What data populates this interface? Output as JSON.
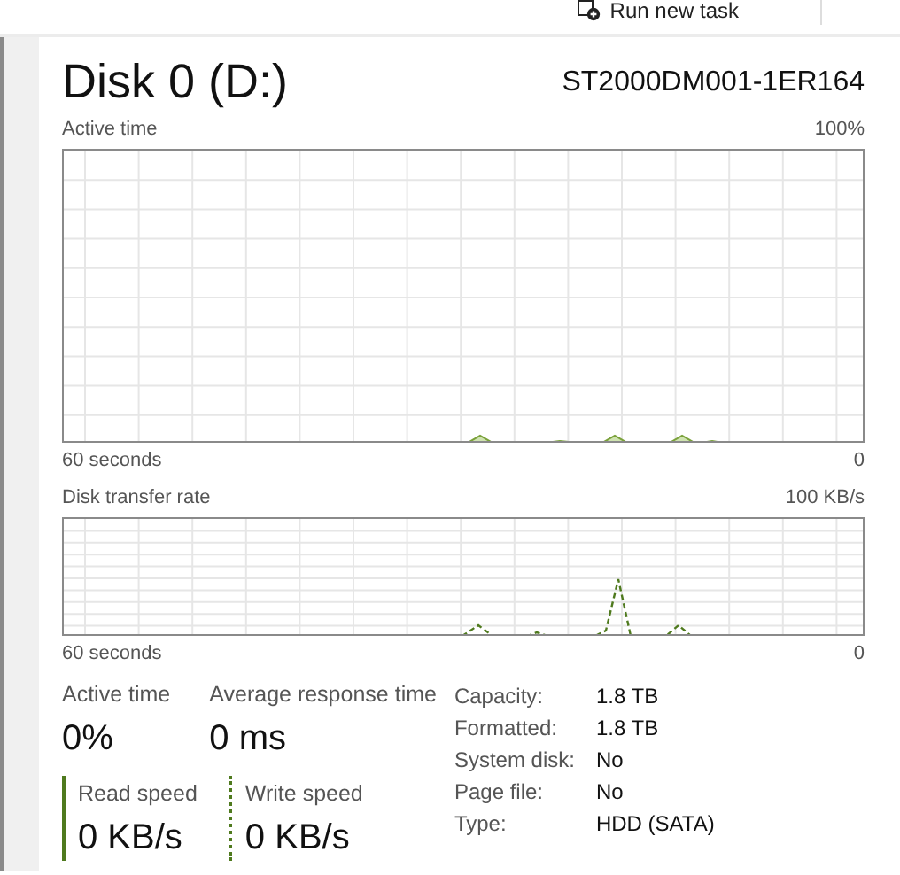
{
  "toolbar": {
    "run_new_task": "Run new task"
  },
  "header": {
    "title": "Disk 0 (D:)",
    "model": "ST2000DM001-1ER164"
  },
  "graphs": [
    {
      "kind": "active",
      "label": "Active time",
      "max": "100%",
      "time_span": "60 seconds",
      "min": "0"
    },
    {
      "kind": "transfer",
      "label": "Disk transfer rate",
      "max": "100 KB/s",
      "time_span": "60 seconds",
      "min": "0"
    }
  ],
  "stats": [
    {
      "label": "Active time",
      "value": "0%"
    },
    {
      "label": "Average response time",
      "value": "0 ms"
    }
  ],
  "speeds": [
    {
      "kind": "read",
      "label": "Read speed",
      "value": "0 KB/s"
    },
    {
      "kind": "write",
      "label": "Write speed",
      "value": "0 KB/s"
    }
  ],
  "properties": [
    {
      "label": "Capacity:",
      "value": "1.8 TB"
    },
    {
      "label": "Formatted:",
      "value": "1.8 TB"
    },
    {
      "label": "System disk:",
      "value": "No"
    },
    {
      "label": "Page file:",
      "value": "No"
    },
    {
      "label": "Type:",
      "value": "HDD (SATA)"
    }
  ]
}
